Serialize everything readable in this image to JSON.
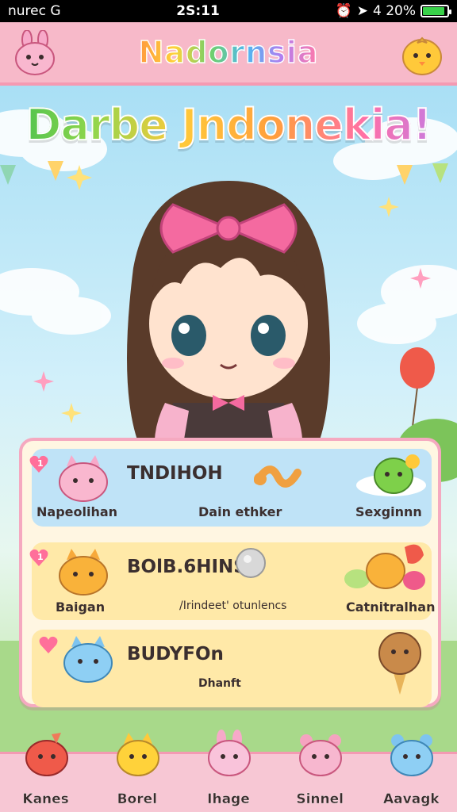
{
  "status": {
    "carrier": "nurec G",
    "time": "2S:11",
    "battery": "4 20%",
    "battery_level": 0.9
  },
  "header": {
    "title": "Nadornsia",
    "left_icon": "pink-bunny-icon",
    "right_icon": "yellow-chick-icon"
  },
  "banner": {
    "text": "Darbe Jndonekia!"
  },
  "panel": {
    "rows": [
      {
        "title": "TNDIHOH",
        "label_left": "Napeolihan",
        "label_mid": "Dain ethker",
        "label_right": "Sexginnn",
        "badge": "1"
      },
      {
        "title": "BOlB.6HINS",
        "label_left": "Baigan",
        "label_mid": "/Irindeet' otunlencs",
        "label_right": "Catnitralhan",
        "badge": "1"
      },
      {
        "title": "BUDYFOn",
        "label_mid": "Dhanft"
      }
    ]
  },
  "nav": [
    {
      "label": "Kanes",
      "icon": "red-cat-icon",
      "color": "#ef5a4a"
    },
    {
      "label": "Borel",
      "icon": "yellow-cat-icon",
      "color": "#ffc93a"
    },
    {
      "label": "Ihage",
      "icon": "pink-bunny-icon",
      "color": "#f7a9c9"
    },
    {
      "label": "Sinnel",
      "icon": "pink-bear-icon",
      "color": "#f5a3c0"
    },
    {
      "label": "Aavagk",
      "icon": "blue-bear-icon",
      "color": "#7ec4f0"
    }
  ]
}
